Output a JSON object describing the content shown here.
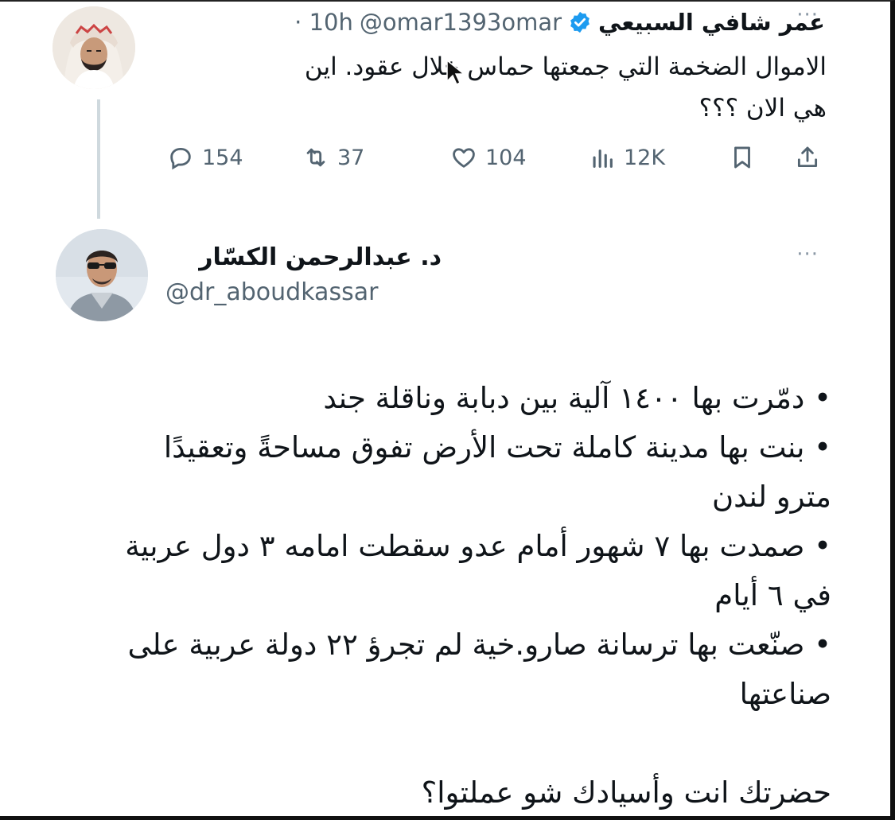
{
  "tweet1": {
    "author_name": "عمر شافي السبيعي",
    "handle": "@omar1393omar",
    "time": "· 10h",
    "more_label": "···",
    "text_lines": [
      "الاموال الضخمة التي جمعتها حماس خلال عقود. اين",
      "هي الان ؟؟؟"
    ],
    "actions": {
      "replies": "154",
      "retweets": "37",
      "likes": "104",
      "views": "12K"
    }
  },
  "tweet2": {
    "author_name": "د. عبدالرحمن الكسّار",
    "handle": "@dr_aboudkassar",
    "more_label": "···",
    "lines": [
      "• دمّرت بها ١٤٠٠ آلية بين دبابة وناقلة جند",
      "• بنت بها مدينة كاملة تحت الأرض تفوق مساحةً وتعقيدًا",
      "مترو لندن",
      "• صمدت بها ٧ شهور أمام عدو سقطت امامه ٣ دول عربية",
      "في ٦ أيام",
      "• صنّعت بها ترسانة صارو.خية لم تجرؤ ٢٢ دولة عربية على",
      "صناعتها",
      "",
      "حضرتك انت وأسيادك شو عملتوا؟"
    ]
  },
  "colors": {
    "text": "#0f1419",
    "muted": "#536471",
    "verified": "#1d9bf0",
    "thread_line": "#cfd9de"
  }
}
